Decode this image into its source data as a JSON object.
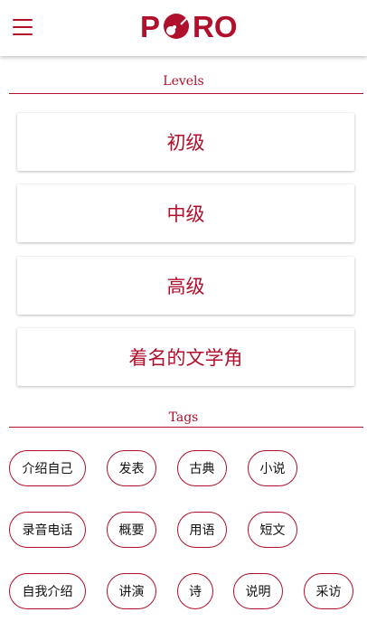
{
  "header": {
    "logo_p": "P",
    "logo_ro": "RO",
    "menu_icon": "hamburger-menu-icon",
    "accent_color": "#b0102c"
  },
  "levels": {
    "title": "Levels",
    "items": [
      "初级",
      "中级",
      "高级",
      "着名的文学角"
    ]
  },
  "tags": {
    "title": "Tags",
    "rows": [
      [
        "介绍自己",
        "发表",
        "古典",
        "小说"
      ],
      [
        "录音电话",
        "概要",
        "用语",
        "短文"
      ],
      [
        "自我介绍",
        "讲演",
        "诗",
        "说明",
        "采访"
      ]
    ]
  }
}
